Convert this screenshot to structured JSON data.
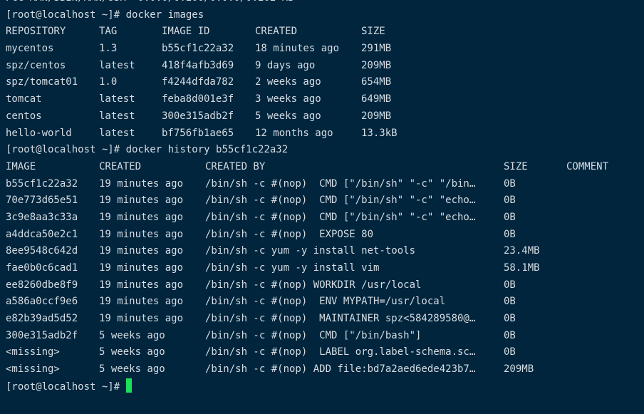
{
  "terminal": {
    "top_partial_line": "PCC MAN/SBIN/MAN/USR  0.0.0/0.200/0.0.0/0.202 MB",
    "prompt": "[root@localhost ~]#",
    "cmd_images": "docker images",
    "cmd_history": "docker history b55cf1c22a32",
    "images_table": {
      "headers": [
        "REPOSITORY",
        "TAG",
        "IMAGE ID",
        "CREATED",
        "SIZE"
      ],
      "rows": [
        [
          "mycentos",
          "1.3",
          "b55cf1c22a32",
          "18 minutes ago",
          "291MB"
        ],
        [
          "spz/centos",
          "latest",
          "418f4afb3d69",
          "9 days ago",
          "209MB"
        ],
        [
          "spz/tomcat01",
          "1.0",
          "f4244dfda782",
          "2 weeks ago",
          "654MB"
        ],
        [
          "tomcat",
          "latest",
          "feba8d001e3f",
          "3 weeks ago",
          "649MB"
        ],
        [
          "centos",
          "latest",
          "300e315adb2f",
          "5 weeks ago",
          "209MB"
        ],
        [
          "hello-world",
          "latest",
          "bf756fb1ae65",
          "12 months ago",
          "13.3kB"
        ]
      ]
    },
    "history_table": {
      "headers": [
        "IMAGE",
        "CREATED",
        "CREATED BY",
        "SIZE",
        "COMMENT"
      ],
      "rows": [
        [
          "b55cf1c22a32",
          "19 minutes ago",
          "/bin/sh -c #(nop)  CMD [\"/bin/sh\" \"-c\" \"/bin…",
          "0B",
          ""
        ],
        [
          "70e773d65e51",
          "19 minutes ago",
          "/bin/sh -c #(nop)  CMD [\"/bin/sh\" \"-c\" \"echo…",
          "0B",
          ""
        ],
        [
          "3c9e8aa3c33a",
          "19 minutes ago",
          "/bin/sh -c #(nop)  CMD [\"/bin/sh\" \"-c\" \"echo…",
          "0B",
          ""
        ],
        [
          "a4ddca50e2c1",
          "19 minutes ago",
          "/bin/sh -c #(nop)  EXPOSE 80",
          "0B",
          ""
        ],
        [
          "8ee9548c642d",
          "19 minutes ago",
          "/bin/sh -c yum -y install net-tools",
          "23.4MB",
          ""
        ],
        [
          "fae0b0c6cad1",
          "19 minutes ago",
          "/bin/sh -c yum -y install vim",
          "58.1MB",
          ""
        ],
        [
          "ee8260dbe8f9",
          "19 minutes ago",
          "/bin/sh -c #(nop) WORKDIR /usr/local",
          "0B",
          ""
        ],
        [
          "a586a0ccf9e6",
          "19 minutes ago",
          "/bin/sh -c #(nop)  ENV MYPATH=/usr/local",
          "0B",
          ""
        ],
        [
          "e82b39ad5d52",
          "19 minutes ago",
          "/bin/sh -c #(nop)  MAINTAINER spz<584289580@…",
          "0B",
          ""
        ],
        [
          "300e315adb2f",
          "5 weeks ago",
          "/bin/sh -c #(nop)  CMD [\"/bin/bash\"]",
          "0B",
          ""
        ],
        [
          "<missing>",
          "5 weeks ago",
          "/bin/sh -c #(nop)  LABEL org.label-schema.sc…",
          "0B",
          ""
        ],
        [
          "<missing>",
          "5 weeks ago",
          "/bin/sh -c #(nop) ADD file:bd7a2aed6ede423b7…",
          "209MB",
          ""
        ]
      ]
    },
    "colors": {
      "background": "#00253d",
      "text": "#d4dce3",
      "cursor": "#1be05a"
    }
  }
}
